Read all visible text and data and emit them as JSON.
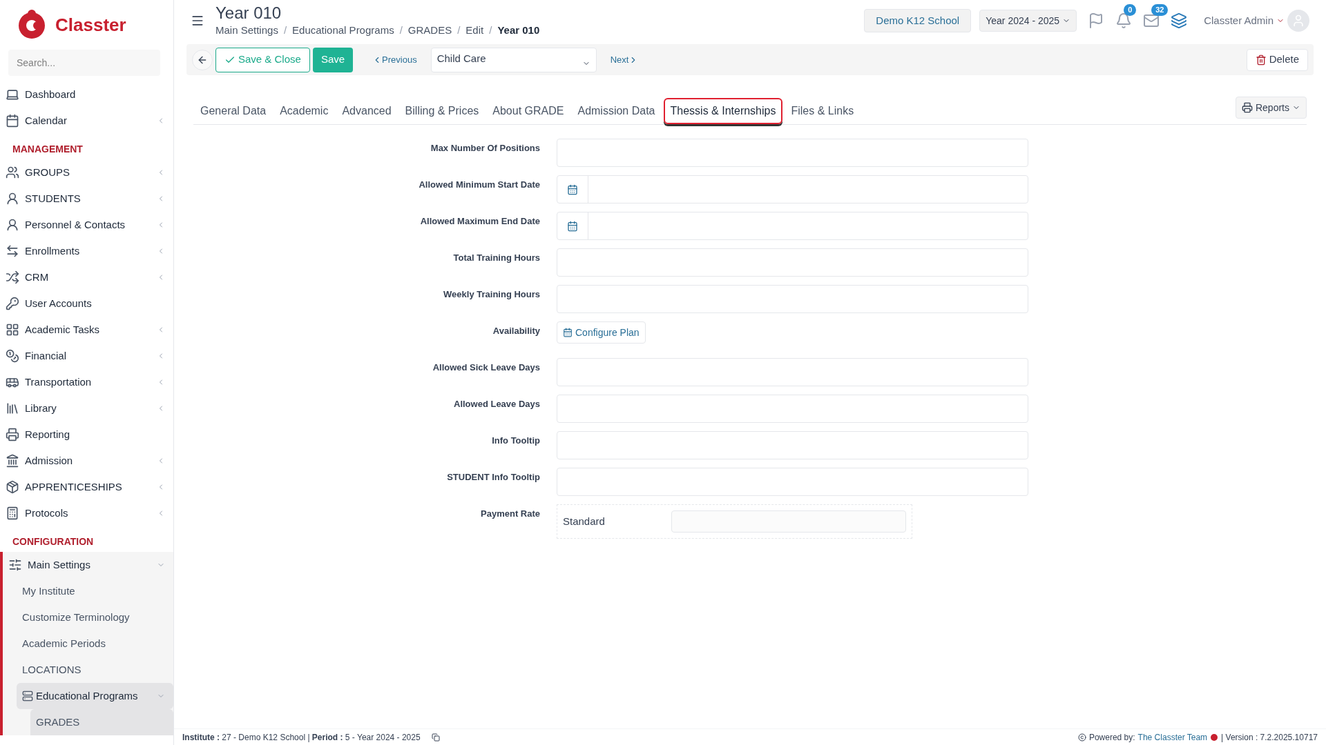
{
  "brand": {
    "name": "Classter"
  },
  "search": {
    "placeholder": "Search..."
  },
  "sidebar": {
    "top_items": [
      {
        "label": "Dashboard",
        "kind": "link"
      },
      {
        "label": "Calendar",
        "kind": "menu",
        "expanded": false
      }
    ],
    "sections": [
      {
        "title": "MANAGEMENT",
        "items": [
          {
            "label": "GROUPS",
            "kind": "menu",
            "expanded": false
          },
          {
            "label": "STUDENTS",
            "kind": "menu",
            "expanded": false
          },
          {
            "label": "Personnel & Contacts",
            "kind": "menu",
            "expanded": false
          },
          {
            "label": "Enrollments",
            "kind": "menu",
            "expanded": false
          },
          {
            "label": "CRM",
            "kind": "menu",
            "expanded": false
          },
          {
            "label": "User Accounts",
            "kind": "link"
          },
          {
            "label": "Academic Tasks",
            "kind": "menu",
            "expanded": false
          },
          {
            "label": "Financial",
            "kind": "menu",
            "expanded": false
          },
          {
            "label": "Transportation",
            "kind": "menu",
            "expanded": false
          },
          {
            "label": "Library",
            "kind": "menu",
            "expanded": false
          },
          {
            "label": "Reporting",
            "kind": "link"
          },
          {
            "label": "Admission",
            "kind": "menu",
            "expanded": false
          },
          {
            "label": "APPRENTICESHIPS",
            "kind": "menu",
            "expanded": false
          },
          {
            "label": "Protocols",
            "kind": "menu",
            "expanded": false
          }
        ]
      },
      {
        "title": "CONFIGURATION",
        "items": [
          {
            "label": "Main Settings",
            "kind": "menu",
            "expanded": true,
            "children": [
              {
                "label": "My Institute",
                "kind": "link"
              },
              {
                "label": "Customize Terminology",
                "kind": "link"
              },
              {
                "label": "Academic Periods",
                "kind": "link"
              },
              {
                "label": "LOCATIONS",
                "kind": "link"
              },
              {
                "label": "Educational Programs",
                "kind": "menu",
                "expanded": true,
                "children": [
                  {
                    "label": "GRADES",
                    "selected": true
                  }
                ]
              }
            ]
          }
        ]
      }
    ]
  },
  "page": {
    "title": "Year 010",
    "breadcrumb": [
      "Main Settings",
      "Educational Programs",
      "GRADES",
      "Edit",
      "Year 010"
    ],
    "breadcrumb_separator": "/"
  },
  "header": {
    "school": "Demo K12 School",
    "year": "Year 2024 - 2025",
    "notifications": "0",
    "messages": "32",
    "user": "Classter Admin"
  },
  "toolbar": {
    "save_close": "Save & Close",
    "save": "Save",
    "previous": "Previous",
    "record": "Child Care",
    "next": "Next",
    "delete": "Delete"
  },
  "tabs": [
    {
      "label": "General Data",
      "selected": false
    },
    {
      "label": "Academic",
      "selected": false
    },
    {
      "label": "Advanced",
      "selected": false
    },
    {
      "label": "Billing & Prices",
      "selected": false
    },
    {
      "label": "About GRADE",
      "selected": false
    },
    {
      "label": "Admission Data",
      "selected": false
    },
    {
      "label": "Thessis & Internships",
      "selected": true
    },
    {
      "label": "Files & Links",
      "selected": false
    }
  ],
  "reports": "Reports",
  "form": [
    {
      "label": "Max Number Of Positions",
      "kind": "text"
    },
    {
      "label": "Allowed Minimum Start Date",
      "kind": "date"
    },
    {
      "label": "Allowed Maximum End Date",
      "kind": "date"
    },
    {
      "label": "Total Training Hours",
      "kind": "text"
    },
    {
      "label": "Weekly Training Hours",
      "kind": "text"
    },
    {
      "label": "Availability",
      "kind": "button",
      "button": "Configure Plan"
    },
    {
      "label": "Allowed Sick Leave Days",
      "kind": "text"
    },
    {
      "label": "Allowed Leave Days",
      "kind": "text"
    },
    {
      "label": "Info Tooltip",
      "kind": "text"
    },
    {
      "label": "STUDENT Info Tooltip",
      "kind": "text"
    },
    {
      "label": "Payment Rate",
      "kind": "rate",
      "rate": "Standard"
    }
  ],
  "footer": {
    "left": "**Institute :** 27 - Demo K12 School | **Period :** 5 - Year 2024 - 2025",
    "powered": "Powered by:",
    "team": "The Classter Team",
    "version": "| Version : 7.2.2025.10717"
  }
}
